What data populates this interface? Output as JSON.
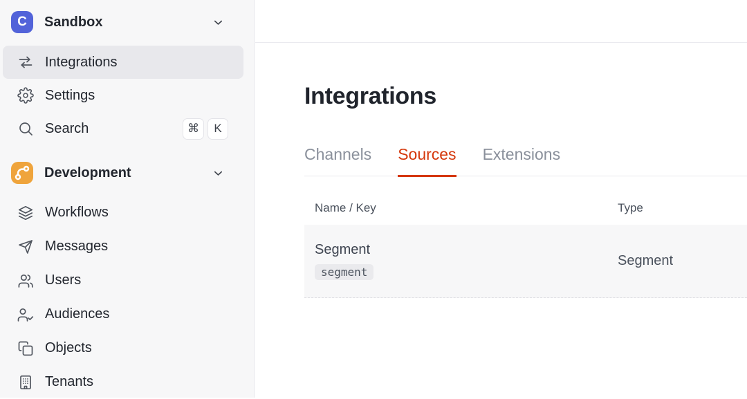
{
  "colors": {
    "accent_red": "#D5380C",
    "logo_bg": "#5263D9",
    "dev_icon_bg": "#EFA43C",
    "sidebar_bg": "#F7F7F8",
    "active_item_bg": "#E8E8EC"
  },
  "sidebar": {
    "workspace": {
      "label": "Sandbox",
      "logo_letter": "C"
    },
    "items": [
      {
        "label": "Integrations",
        "icon": "swap-arrows-icon",
        "active": true
      },
      {
        "label": "Settings",
        "icon": "gear-icon",
        "active": false
      },
      {
        "label": "Search",
        "icon": "search-icon",
        "active": false,
        "shortcut": [
          "⌘",
          "K"
        ]
      }
    ],
    "section": {
      "label": "Development",
      "icon": "branch-icon"
    },
    "dev_items": [
      {
        "label": "Workflows",
        "icon": "layers-icon"
      },
      {
        "label": "Messages",
        "icon": "paper-plane-icon"
      },
      {
        "label": "Users",
        "icon": "users-icon"
      },
      {
        "label": "Audiences",
        "icon": "user-check-icon"
      },
      {
        "label": "Objects",
        "icon": "copy-icon"
      },
      {
        "label": "Tenants",
        "icon": "building-icon"
      }
    ]
  },
  "main": {
    "title": "Integrations",
    "tabs": [
      {
        "label": "Channels",
        "active": false
      },
      {
        "label": "Sources",
        "active": true
      },
      {
        "label": "Extensions",
        "active": false
      }
    ],
    "table": {
      "columns": [
        "Name / Key",
        "Type"
      ],
      "rows": [
        {
          "name": "Segment",
          "key": "segment",
          "type": "Segment"
        }
      ]
    }
  }
}
